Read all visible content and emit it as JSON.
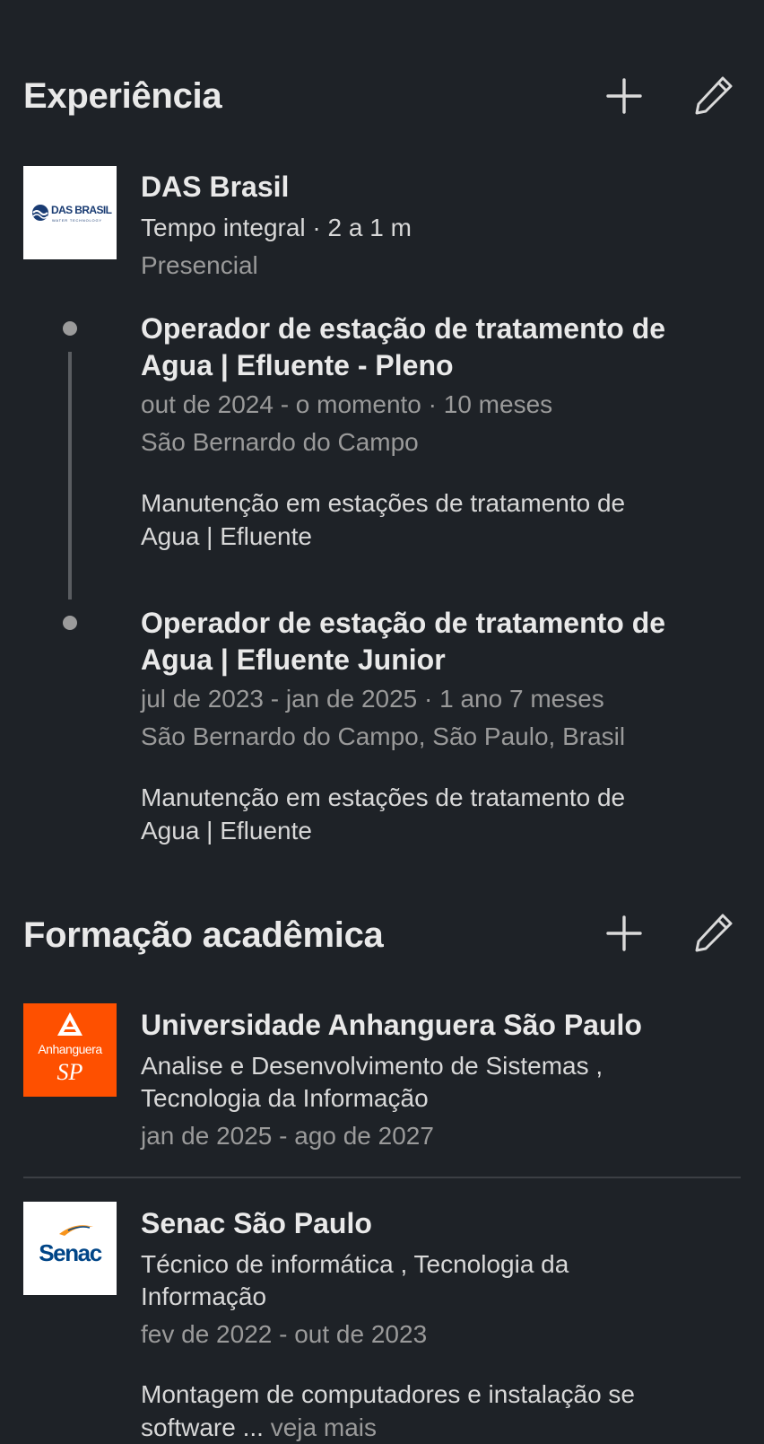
{
  "experience": {
    "title": "Experiência",
    "company": {
      "name": "DAS Brasil",
      "logo_text": "DAS BRASIL",
      "logo_subtext": "WATER TECHNOLOGY",
      "employment": "Tempo integral · 2 a 1 m",
      "workplace": "Presencial"
    },
    "roles": [
      {
        "title_line1": "Operador de estação de tratamento de",
        "title_line2": "Agua | Efluente - Pleno",
        "dates": "out de 2024 - o momento · 10 meses",
        "location": "São Bernardo do Campo",
        "description_line1": "Manutenção em estações de tratamento de",
        "description_line2": "Agua | Efluente"
      },
      {
        "title_line1": "Operador de estação de tratamento de",
        "title_line2": "Agua | Efluente Junior",
        "dates": "jul de 2023 - jan de 2025 · 1 ano 7 meses",
        "location": "São Bernardo do Campo, São Paulo, Brasil",
        "description_line1": "Manutenção em estações de tratamento de",
        "description_line2": "Agua | Efluente"
      }
    ]
  },
  "education": {
    "title": "Formação acadêmica",
    "schools": [
      {
        "name": "Universidade Anhanguera São Paulo",
        "logo_text": "Anhanguera",
        "logo_subtext": "SP",
        "degree_line1": "Analise e Desenvolvimento de Sistemas ,",
        "degree_line2": "Tecnologia da Informação",
        "dates": "jan de 2025 - ago de 2027"
      },
      {
        "name": "Senac São Paulo",
        "logo_text": "Senac",
        "degree_line1": "Técnico de informática , Tecnologia da",
        "degree_line2": "Informação",
        "dates": "fev de 2022 - out de 2023",
        "description_line1": "Montagem de computadores e instalação se",
        "description_line2": "software ...",
        "see_more": "veja mais"
      }
    ]
  },
  "colors": {
    "background": "#1e2227",
    "anhanguera": "#fe5000",
    "senac_blue": "#004587",
    "senac_orange": "#f7941d"
  },
  "icons": [
    "plus-icon",
    "pencil-icon"
  ]
}
